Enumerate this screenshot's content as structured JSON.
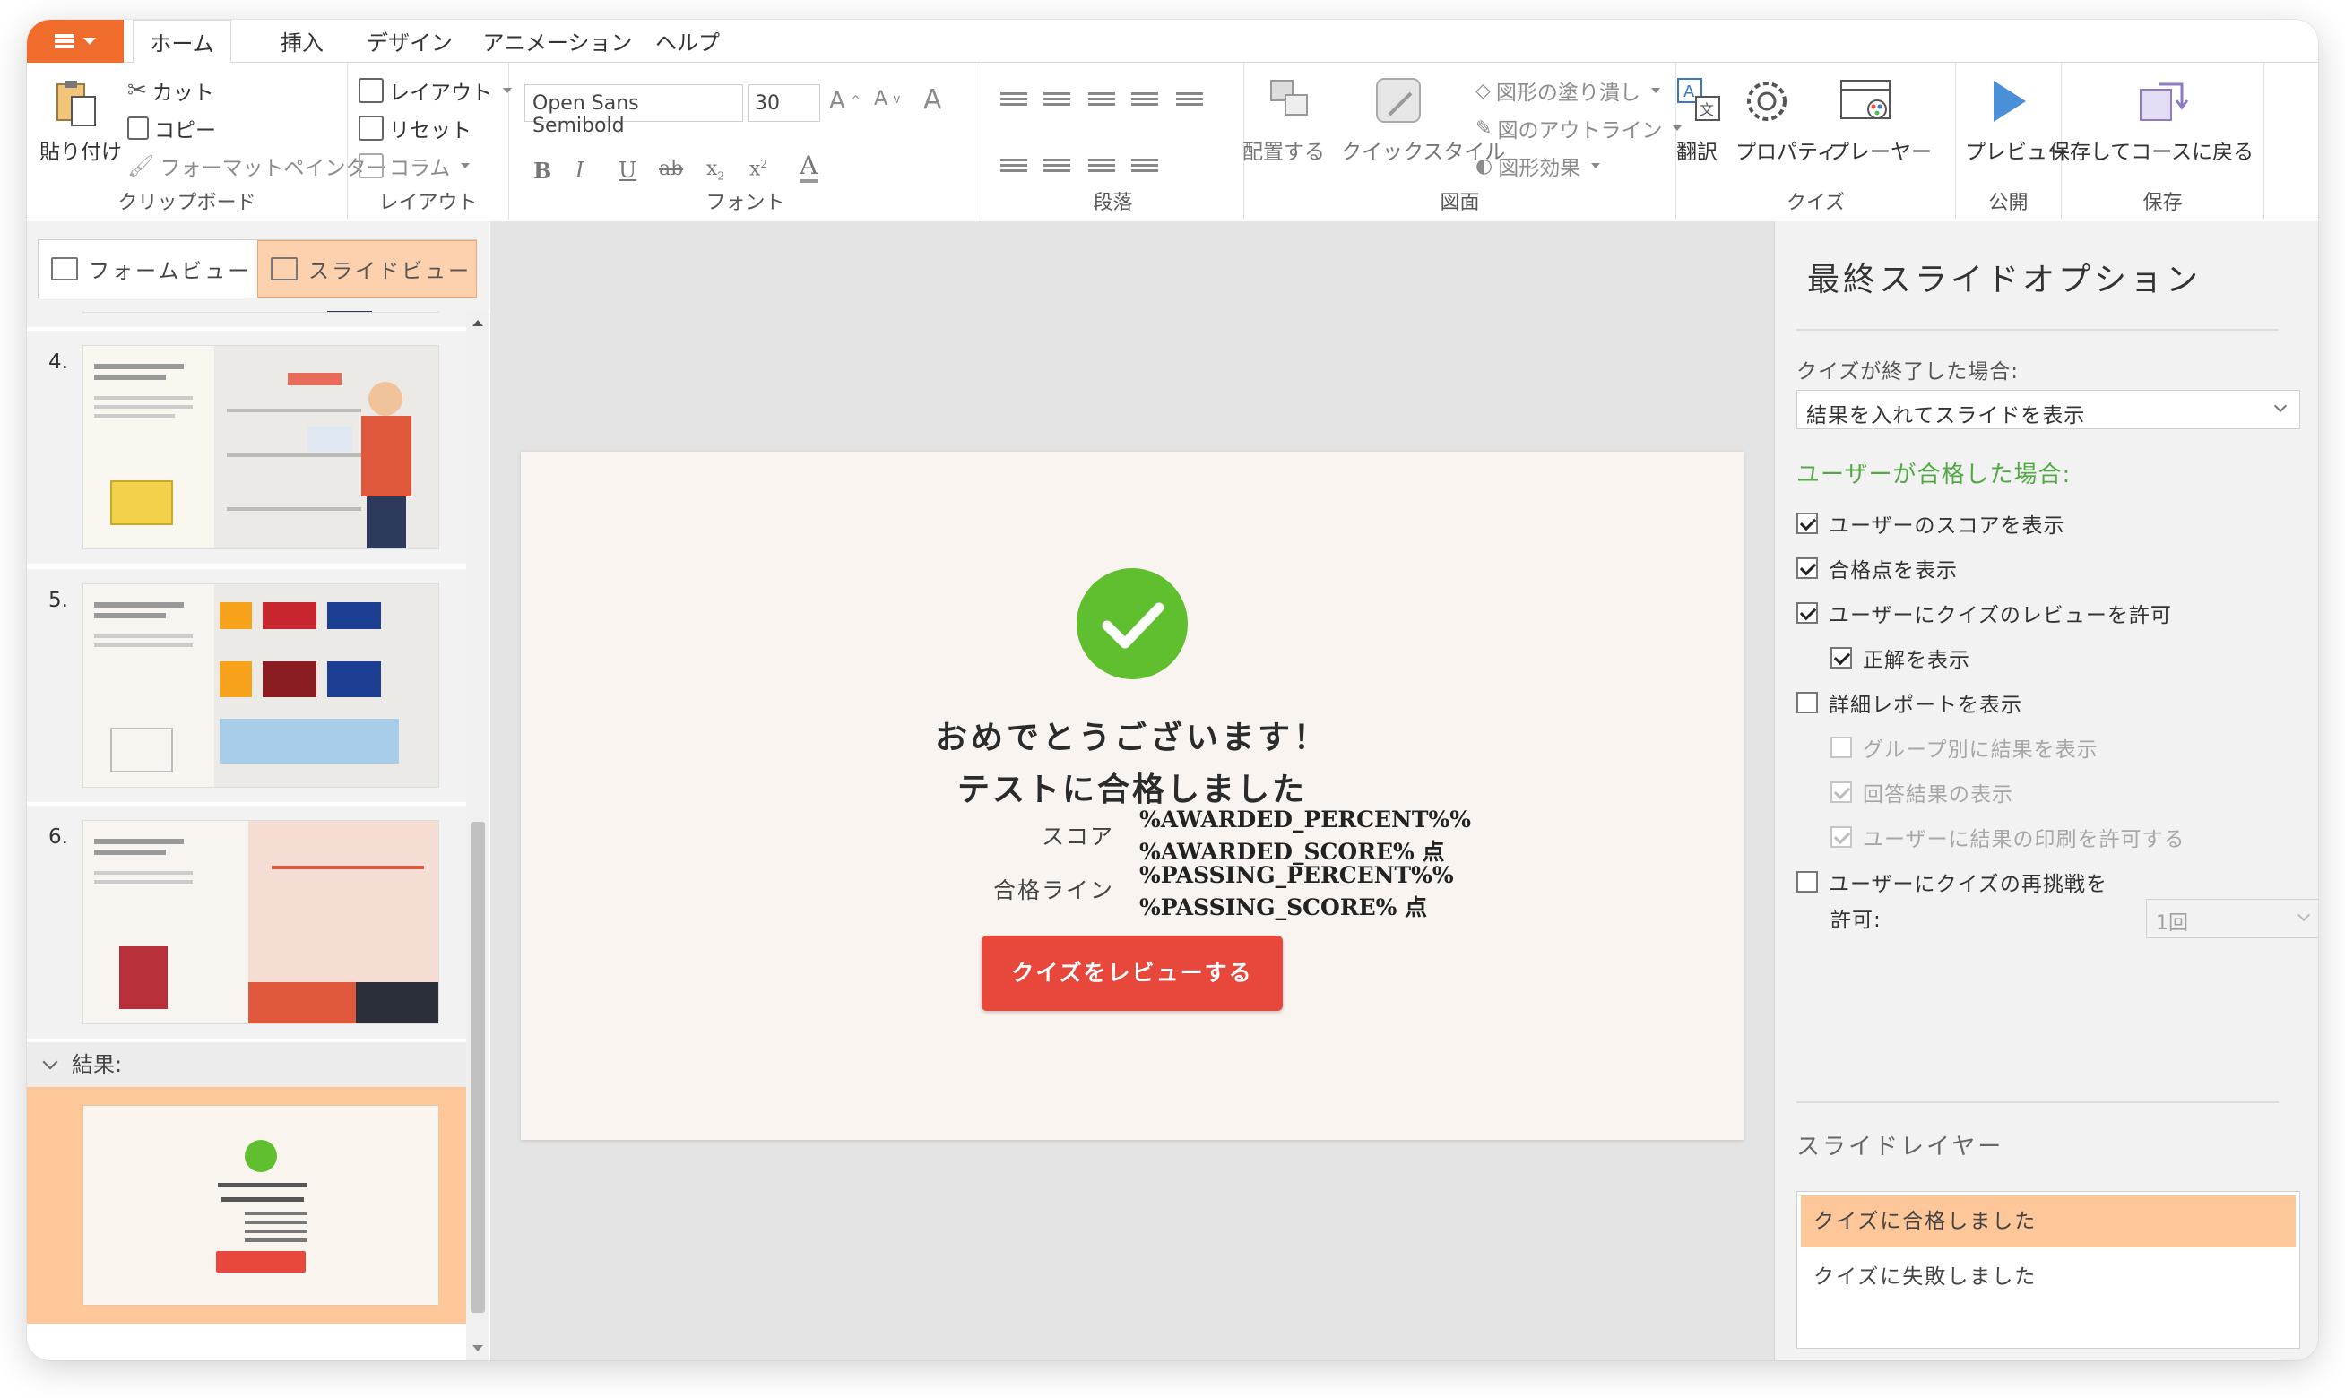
{
  "ribbon": {
    "tabs": [
      "ホーム",
      "挿入",
      "デザイン",
      "アニメーション",
      "ヘルプ"
    ],
    "clipboard": {
      "paste": "貼り付け",
      "cut": "カット",
      "copy": "コピー",
      "format_painter": "フォーマットペインター",
      "label": "クリップボード"
    },
    "layout": {
      "layout": "レイアウト",
      "reset": "リセット",
      "column": "コラム",
      "label": "レイアウト"
    },
    "font": {
      "family": "Open Sans Semibold",
      "size": "30",
      "label": "フォント"
    },
    "paragraph": {
      "label": "段落"
    },
    "drawing": {
      "arrange": "配置する",
      "quick_style": "クイックスタイル",
      "fill": "図形の塗り潰し",
      "outline": "図のアウトライン",
      "effects": "図形効果",
      "label": "図面"
    },
    "quiz": {
      "translate": "翻訳",
      "properties": "プロパティ",
      "player": "プレーヤー",
      "label": "クイズ"
    },
    "publish": {
      "preview": "プレビュー",
      "label": "公開"
    },
    "save": {
      "save_return": "保存してコースに戻る",
      "label": "保存"
    }
  },
  "left_panel": {
    "form_view": "フォームビュー",
    "slide_view": "スライドビュー",
    "slides": [
      {
        "number": "4."
      },
      {
        "number": "5."
      },
      {
        "number": "6."
      }
    ],
    "section_label": "結果:"
  },
  "slide": {
    "congrats": "おめでとうございます！",
    "passed": "テストに合格しました",
    "score_label": "スコア",
    "score_line1": "%AWARDED_PERCENT%%",
    "score_line2": "%AWARDED_SCORE% 点",
    "passing_label": "合格ライン",
    "passing_line1": "%PASSING_PERCENT%%",
    "passing_line2": "%PASSING_SCORE% 点",
    "review_button": "クイズをレビューする",
    "colors": {
      "check": "#5fbf2f",
      "button": "#e8473b",
      "background": "#f9f4ef"
    }
  },
  "right_panel": {
    "title": "最終スライドオプション",
    "when_finished_label": "クイズが終了した場合:",
    "when_finished_value": "結果を入れてスライドを表示",
    "if_passed": "ユーザーが合格した場合:",
    "options": {
      "show_score": "ユーザーのスコアを表示",
      "show_passing": "合格点を表示",
      "allow_review": "ユーザーにクイズのレビューを許可",
      "show_correct": "正解を表示",
      "detailed_report": "詳細レポートを表示",
      "by_group": "グループ別に結果を表示",
      "answer_results": "回答結果の表示",
      "allow_print": "ユーザーに結果の印刷を許可する",
      "allow_retry_1": "ユーザーにクイズの再挑戦を",
      "allow_retry_2": "許可:",
      "retry_value": "1回"
    },
    "layers_title": "スライドレイヤー",
    "layers": [
      "クイズに合格しました",
      "クイズに失敗しました"
    ]
  }
}
